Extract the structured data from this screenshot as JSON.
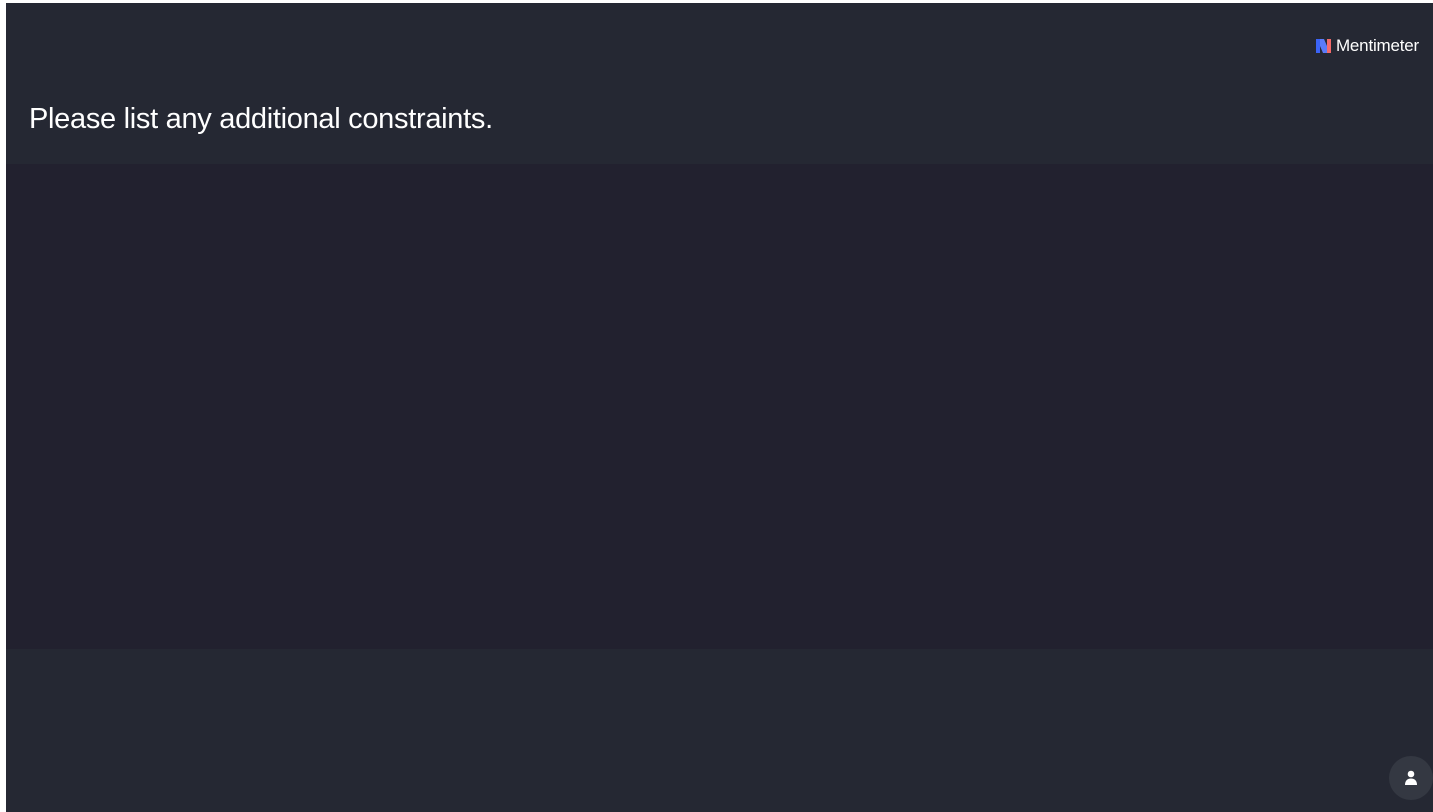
{
  "brand": {
    "name": "Mentimeter",
    "logo_icon": "mentimeter-logo-icon",
    "colors": {
      "logo_left": "#3b63f6",
      "logo_right": "#f36a6a"
    }
  },
  "slide": {
    "question": "Please list any additional constraints."
  },
  "footer": {
    "participant_icon": "person-icon"
  },
  "theme": {
    "header_bg": "#252833",
    "content_bg": "#22212f",
    "text": "#ffffff"
  }
}
